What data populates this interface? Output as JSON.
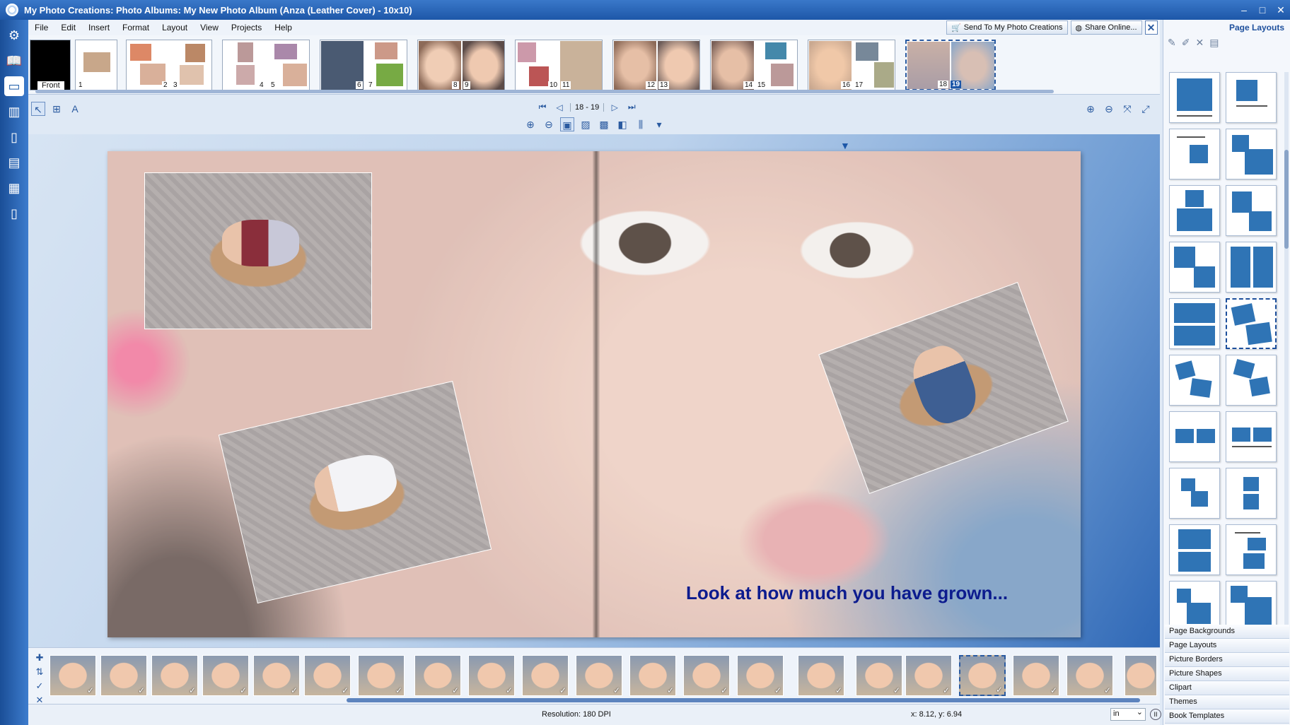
{
  "window": {
    "title": "My Photo Creations: Photo Albums: My New Photo Album (Anza (Leather Cover) - 10x10)"
  },
  "menu": [
    "File",
    "Edit",
    "Insert",
    "Format",
    "Layout",
    "View",
    "Projects",
    "Help"
  ],
  "top_buttons": {
    "send_to": "Send To  My Photo Creations",
    "share": "Share Online..."
  },
  "page_strip": {
    "front_label": "Front",
    "page_numbers": [
      "1",
      "2",
      "3",
      "4",
      "5",
      "6",
      "7",
      "8",
      "9",
      "10",
      "11",
      "12",
      "13",
      "14",
      "15",
      "16",
      "17",
      "18",
      "19"
    ],
    "selected_page": "19"
  },
  "navigation": {
    "page_range": "18 - 19"
  },
  "spread": {
    "caption": "Look at how much you have grown..."
  },
  "status": {
    "resolution": "Resolution: 180 DPI",
    "coords": "x: 8.12, y: 6.94",
    "unit": "in"
  },
  "right_panel": {
    "title": "Page Layouts",
    "tabs": [
      "Page Backgrounds",
      "Page Layouts",
      "Picture Borders",
      "Picture Shapes",
      "Clipart",
      "Themes",
      "Book Templates"
    ]
  },
  "colors": {
    "accent": "#1d57a8",
    "caption": "#0c1b8e",
    "layout_block": "#2f74b5"
  },
  "icons": [
    "gear-icon",
    "book-icon",
    "pointer-icon",
    "zoom-in-icon",
    "zoom-out-icon",
    "cart-icon",
    "globe-icon",
    "close-icon"
  ]
}
